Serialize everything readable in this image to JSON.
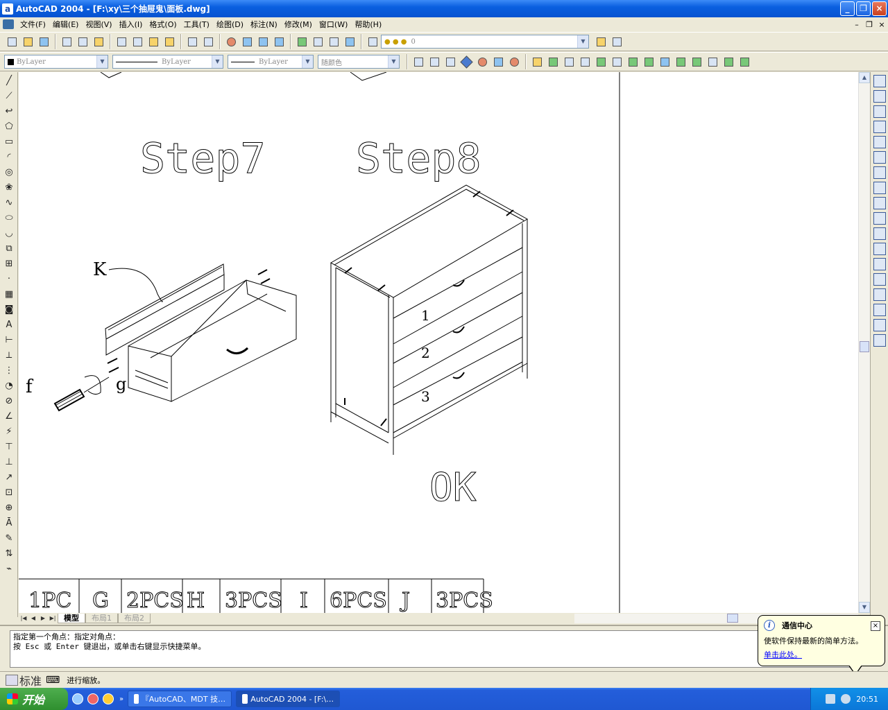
{
  "window": {
    "title": "AutoCAD 2004 - [F:\\xy\\三个抽屉鬼\\面板.dwg]",
    "app_icon": "autocad-icon",
    "minimize": "_",
    "restore": "❐",
    "close": "×"
  },
  "menu": {
    "items": [
      "文件(F)",
      "编辑(E)",
      "视图(V)",
      "插入(I)",
      "格式(O)",
      "工具(T)",
      "绘图(D)",
      "标注(N)",
      "修改(M)",
      "窗口(W)",
      "帮助(H)"
    ],
    "doc_controls": [
      "–",
      "❐",
      "×"
    ]
  },
  "properties_toolbar": {
    "layer_combo": "0",
    "color_combo": "ByLayer",
    "linetype_combo": "ByLayer",
    "lineweight_combo": "ByLayer",
    "plotstyle_combo": "随颜色"
  },
  "drawing": {
    "step7_label": "Step7",
    "step8_label": "Step8",
    "ok_label": "OK",
    "callout_k": "K",
    "callout_f": "f",
    "callout_g": "g",
    "drawer_numbers": [
      "1",
      "2",
      "3"
    ],
    "parts_table": [
      "1PC",
      "G",
      "2PCS",
      "H",
      "3PCS",
      "I",
      "6PCS",
      "J",
      "3PCS"
    ]
  },
  "layout_tabs": {
    "model": "模型",
    "layout1": "布局1",
    "layout2": "布局2"
  },
  "command_line": {
    "line1": "指定第一个角点：指定对角点：",
    "line2": "按 Esc 或 Enter 键退出，或单击右键显示快捷菜单。"
  },
  "status_bar": {
    "left_label": "标准",
    "message": "进行缩放。"
  },
  "balloon": {
    "title": "通信中心",
    "body": "使软件保持最新的简单方法。",
    "link": "单击此处。",
    "close": "×"
  },
  "taskbar": {
    "start_label": "开始",
    "tasks": [
      "『AutoCAD、MDT 技…",
      "AutoCAD 2004 - [F:\\…"
    ],
    "clock": "20:51"
  },
  "colors": {
    "titlebar": "#0a5fe0",
    "chrome": "#ece9d8",
    "canvas": "#ffffff",
    "taskbar": "#245edb",
    "start": "#2f8f2f"
  }
}
